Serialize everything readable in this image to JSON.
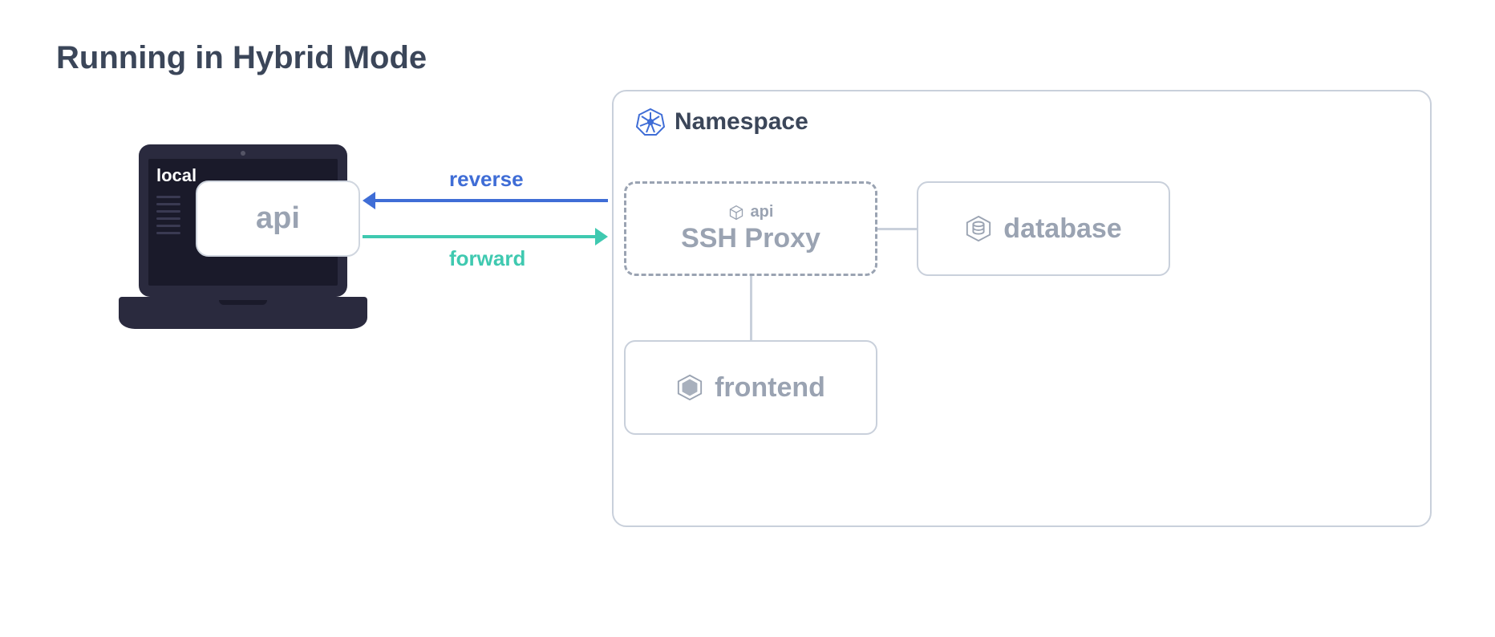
{
  "title": "Running in Hybrid Mode",
  "laptop": {
    "local_label": "local",
    "api_label": "api"
  },
  "arrows": {
    "reverse_label": "reverse",
    "forward_label": "forward"
  },
  "namespace": {
    "title": "Namespace",
    "ssh_proxy": {
      "mini_label": "api",
      "main_label": "SSH Proxy"
    },
    "database_label": "database",
    "frontend_label": "frontend"
  }
}
